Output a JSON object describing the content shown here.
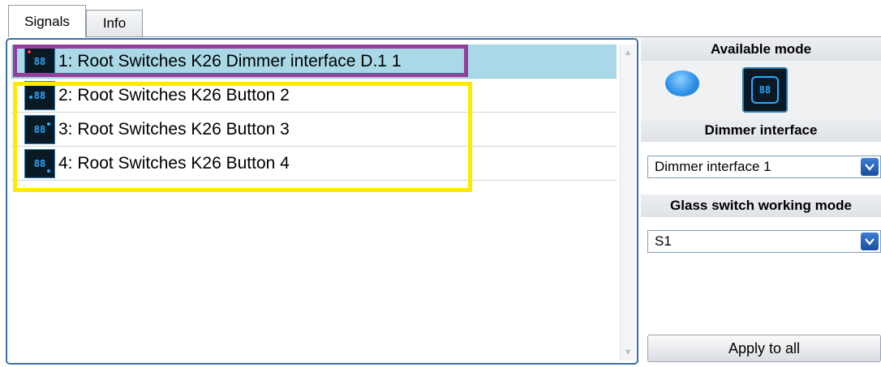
{
  "tabs": [
    {
      "label": "Signals",
      "active": true
    },
    {
      "label": "Info",
      "active": false
    }
  ],
  "signals": [
    {
      "label": "1: Root Switches K26 Dimmer interface D.1 1",
      "selected": true,
      "icon": "dimmer-module-icon"
    },
    {
      "label": "2: Root Switches K26 Button 2",
      "selected": false,
      "icon": "glass-switch-icon"
    },
    {
      "label": "3: Root Switches K26 Button 3",
      "selected": false,
      "icon": "glass-switch-icon"
    },
    {
      "label": "4: Root Switches K26 Button 4",
      "selected": false,
      "icon": "glass-switch-icon"
    }
  ],
  "icon_digits": "88",
  "right": {
    "available_mode_title": "Available mode",
    "modes": [
      "blue-push-button-icon",
      "glass-switch-icon"
    ],
    "dimmer_title": "Dimmer interface",
    "dimmer_value": "Dimmer interface 1",
    "glass_title": "Glass switch working mode",
    "glass_value": "S1",
    "apply_label": "Apply to all"
  },
  "colors": {
    "selected_row": "#a9d8e6",
    "highlight_purple": "#93409b",
    "highlight_yellow": "#ffea00",
    "accent_blue": "#2aa8ff"
  }
}
